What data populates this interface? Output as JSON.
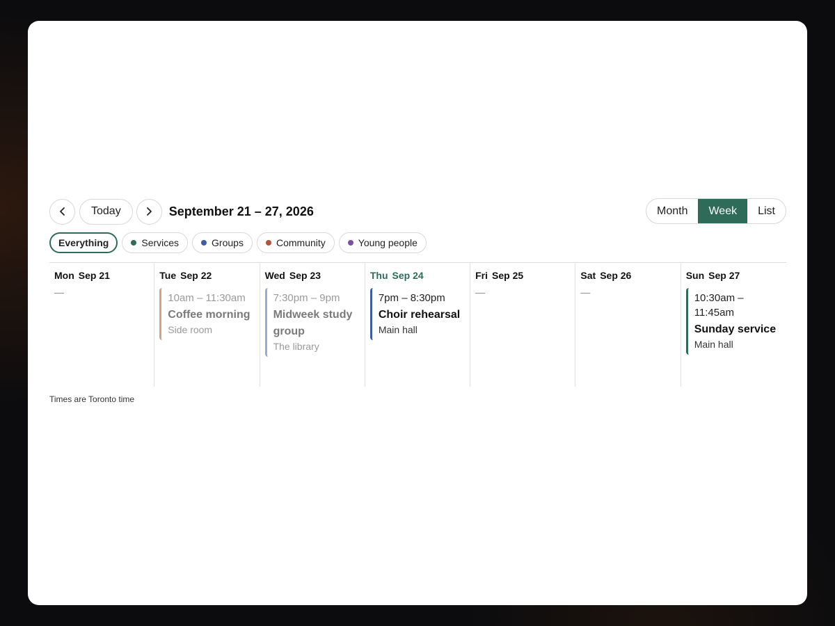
{
  "toolbar": {
    "today_label": "Today",
    "range_title": "September 21 – 27, 2026",
    "views": [
      "Month",
      "Week",
      "List"
    ],
    "active_view": "Week"
  },
  "filters": [
    {
      "label": "Everything",
      "active": true
    },
    {
      "label": "Services",
      "color": "#2e6b58"
    },
    {
      "label": "Groups",
      "color": "#3b5ea8"
    },
    {
      "label": "Community",
      "color": "#b5533a"
    },
    {
      "label": "Young people",
      "color": "#7b4fa6"
    }
  ],
  "days": [
    {
      "dow": "Mon",
      "date": "Sep 21",
      "empty": "—"
    },
    {
      "dow": "Tue",
      "date": "Sep 22",
      "event": {
        "time": "10am – 11:30am",
        "title": "Coffee morning",
        "location": "Side room",
        "color": "#d9a088",
        "faded": true
      }
    },
    {
      "dow": "Wed",
      "date": "Sep 23",
      "event": {
        "time": "7:30pm – 9pm",
        "title": "Midweek study group",
        "location": "The library",
        "color": "#9aaad0",
        "faded": true
      }
    },
    {
      "dow": "Thu",
      "date": "Sep 24",
      "today": true,
      "event": {
        "time": "7pm – 8:30pm",
        "title": "Choir rehearsal",
        "location": "Main hall",
        "color": "#3b5ea8"
      }
    },
    {
      "dow": "Fri",
      "date": "Sep 25",
      "empty": "—"
    },
    {
      "dow": "Sat",
      "date": "Sep 26",
      "empty": "—"
    },
    {
      "dow": "Sun",
      "date": "Sep 27",
      "event": {
        "time": "10:30am – 11:45am",
        "title": "Sunday service",
        "location": "Main hall",
        "color": "#2e6b58"
      }
    }
  ],
  "footnote": "Times are Toronto time"
}
